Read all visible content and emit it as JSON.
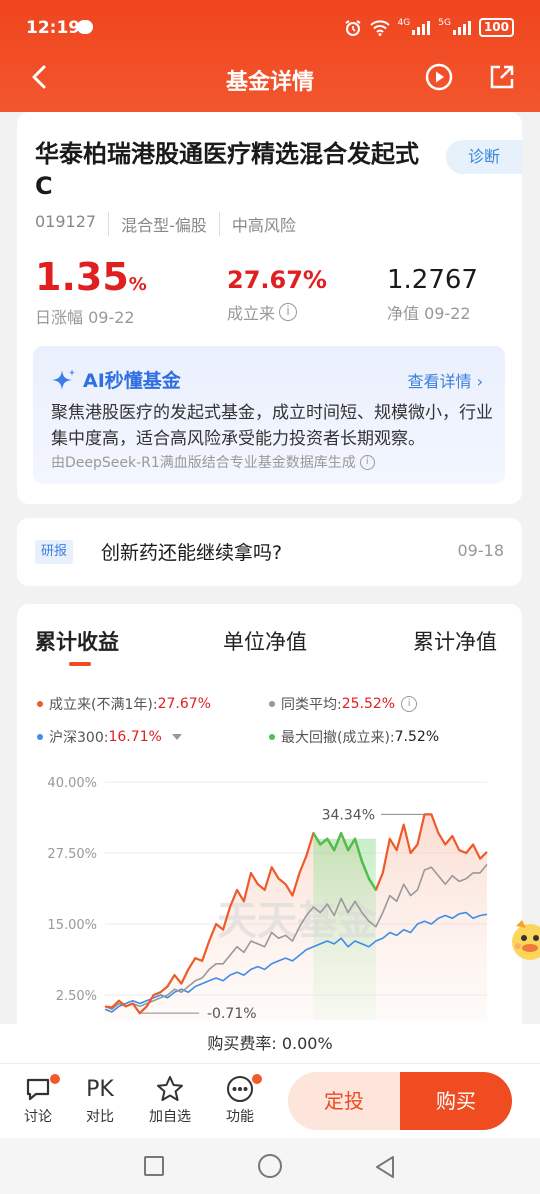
{
  "status_bar": {
    "time": "12:19",
    "net1": "4G",
    "net2": "5G",
    "battery": "100"
  },
  "nav": {
    "title": "基金详情"
  },
  "fund": {
    "name": "华泰柏瑞港股通医疗精选混合发起式C",
    "diagnose_label": "诊断",
    "code": "019127",
    "type": "混合型-偏股",
    "risk": "中高风险",
    "day_change": "1.35",
    "day_change_unit": "%",
    "day_change_label": "日涨幅 09-22",
    "since_inception": "27.67%",
    "since_inception_label": "成立来",
    "nav_value": "1.2767",
    "nav_label": "净值 09-22"
  },
  "ai": {
    "title": "AI秒懂基金",
    "more": "查看详情 ›",
    "text": "聚焦港股医疗的发起式基金，成立时间短、规模微小，行业集中度高，适合高风险承受能力投资者长期观察。",
    "source": "由DeepSeek-R1满血版结合专业基金数据库生成"
  },
  "research": {
    "tag": "研报",
    "title": "创新药还能继续拿吗?",
    "date": "09-18"
  },
  "chart": {
    "tabs": [
      "累计收益",
      "单位净值",
      "累计净值"
    ],
    "legend": [
      {
        "label": "成立来(不满1年):",
        "value": "27.67%",
        "color": "#ef5a2a"
      },
      {
        "label": "同类平均:",
        "value": "25.52%",
        "color": "#999999"
      },
      {
        "label": "沪深300:",
        "value": "16.71%",
        "color": "#3f8de8"
      },
      {
        "label": "最大回撤(成立来):",
        "value": "7.52%",
        "color": "#4cbf4c"
      }
    ],
    "watermark": "天天基金",
    "annotations": {
      "max": "34.34%",
      "min": "-0.71%"
    }
  },
  "chart_data": {
    "type": "line",
    "y_ticks": [
      "40.00%",
      "27.50%",
      "15.00%",
      "2.50%"
    ],
    "ylim": [
      -2,
      40
    ],
    "series": [
      {
        "name": "成立来(不满1年)",
        "color": "#ef5a2a",
        "values": [
          0.5,
          0.3,
          1.5,
          0.5,
          1.0,
          -0.7,
          0.5,
          2.5,
          3.0,
          4.0,
          6.0,
          4.5,
          7.0,
          9.0,
          8.5,
          12.0,
          15.0,
          14.0,
          18.0,
          21.0,
          19.0,
          24.0,
          22.0,
          21.0,
          25.0,
          23.0,
          22.0,
          20.0,
          24.0,
          27.0,
          31.0,
          29.0,
          30.0,
          28.0,
          31.0,
          28.0,
          30.0,
          26.0,
          23.0,
          21.0,
          24.0,
          30.0,
          28.0,
          32.5,
          27.5,
          29.0,
          34.3,
          34.3,
          31.0,
          29.0,
          30.5,
          28.0,
          27.5,
          29.0,
          26.5,
          27.7
        ]
      },
      {
        "name": "同类平均",
        "color": "#999999",
        "values": [
          0.5,
          0.0,
          1.0,
          0.5,
          1.0,
          0.5,
          1.0,
          1.5,
          2.0,
          2.5,
          3.5,
          3.0,
          4.0,
          5.0,
          5.5,
          7.0,
          8.0,
          8.0,
          9.5,
          11.0,
          10.0,
          12.0,
          11.5,
          11.0,
          13.5,
          12.5,
          13.0,
          12.0,
          14.5,
          16.5,
          18.0,
          17.0,
          18.5,
          16.5,
          19.5,
          17.0,
          19.0,
          17.0,
          15.5,
          14.5,
          17.0,
          20.0,
          19.0,
          22.0,
          20.0,
          21.0,
          24.5,
          25.0,
          23.5,
          22.0,
          23.5,
          22.5,
          23.0,
          24.0,
          24.0,
          25.5
        ]
      },
      {
        "name": "沪深300",
        "color": "#3f8de8",
        "values": [
          0.0,
          -0.5,
          0.5,
          1.0,
          1.5,
          1.0,
          1.5,
          2.0,
          2.5,
          2.0,
          3.0,
          3.5,
          3.0,
          4.0,
          4.5,
          5.0,
          5.5,
          5.0,
          6.0,
          6.5,
          6.0,
          7.0,
          7.5,
          7.0,
          8.0,
          8.5,
          9.0,
          8.5,
          9.5,
          10.5,
          11.0,
          11.5,
          12.0,
          11.5,
          12.5,
          11.0,
          12.0,
          11.5,
          11.0,
          12.0,
          12.5,
          13.5,
          13.0,
          14.0,
          13.5,
          15.0,
          15.5,
          15.0,
          16.0,
          16.5,
          16.0,
          16.8,
          17.0,
          16.0,
          16.5,
          16.7
        ]
      }
    ],
    "drawdown_range": [
      30,
      39
    ]
  },
  "fee": {
    "label": "购买费率:",
    "value": "0.00%"
  },
  "bottom": {
    "items": [
      "讨论",
      "对比",
      "加自选",
      "功能"
    ],
    "pk": "PK",
    "dingtou": "定投",
    "buy": "购买"
  }
}
